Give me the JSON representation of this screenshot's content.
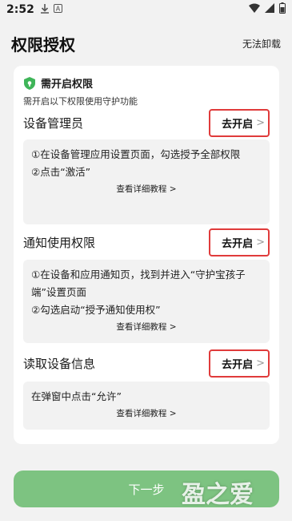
{
  "status_bar": {
    "time": "2:52",
    "icons": [
      "download-icon",
      "app-a-icon",
      "wifi-icon",
      "signal-icon",
      "battery-icon"
    ]
  },
  "header": {
    "title": "权限授权",
    "right_action": "无法卸载"
  },
  "card": {
    "header": {
      "title": "需开启权限",
      "subtitle": "需开启以下权限使用守护功能"
    },
    "permissions": [
      {
        "title": "设备管理员",
        "action_label": "去开启",
        "instructions": [
          "①在设备管理应用设置页面，勾选授予全部权限",
          "②点击“激活”"
        ],
        "tutorial_link": "查看详细教程 >"
      },
      {
        "title": "通知使用权限",
        "action_label": "去开启",
        "instructions": [
          "①在设备和应用通知页，找到并进入“守护宝孩子端”设置页面",
          "②勾选启动“授予通知使用权”"
        ],
        "tutorial_link": "查看详细教程 >"
      },
      {
        "title": "读取设备信息",
        "action_label": "去开启",
        "instructions": [
          "在弹窗中点击“允许”"
        ],
        "tutorial_link": "查看详细教程 >"
      }
    ]
  },
  "footer": {
    "next_label": "下一步"
  },
  "watermark": {
    "text": "盈之爱"
  },
  "colors": {
    "accent_green": "#7dc381",
    "highlight_red": "#e03b3b",
    "shield_green": "#3fb559"
  }
}
